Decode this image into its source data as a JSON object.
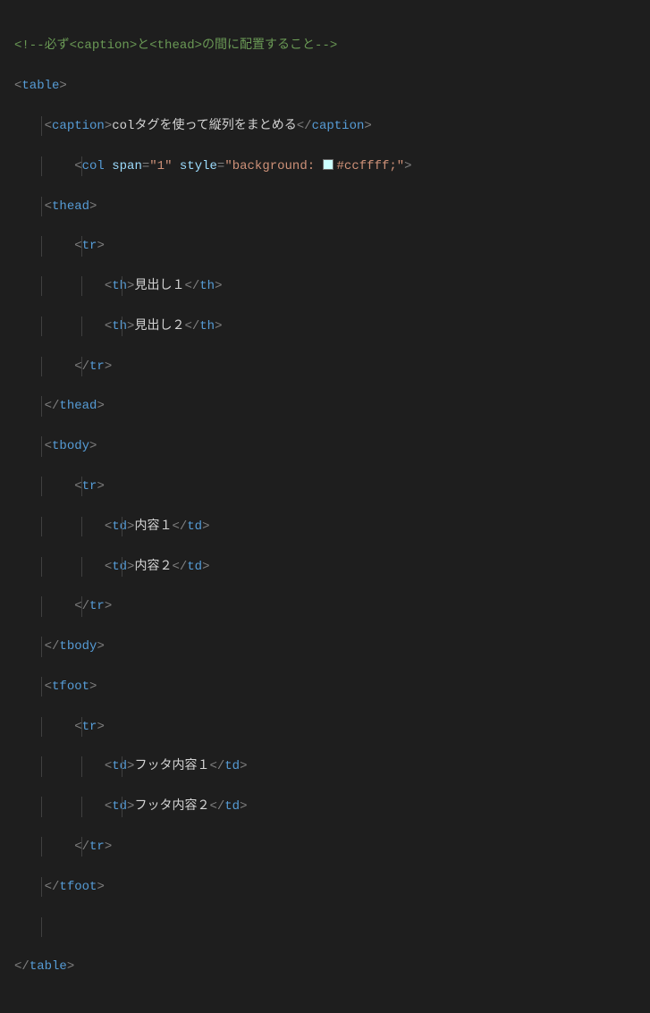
{
  "code": {
    "comment_prefix": "<!--",
    "comment_text1": "必ず",
    "comment_caption": "<caption>",
    "comment_text2": "と",
    "comment_thead": "<thead>",
    "comment_text3": "の間に配置すること",
    "comment_suffix": "-->",
    "table_open_lt": "<",
    "table_tag": "table",
    "gt": ">",
    "caption_tag": "caption",
    "caption_text": "colタグを使って縦列をまとめる",
    "lt_slash": "</",
    "col_tag": "col",
    "span_attr": "span",
    "eq": "=",
    "span_val": "\"1\"",
    "style_attr": "style",
    "style_val_before": "\"background: ",
    "style_val_after": "#ccffff;\"",
    "thead_tag": "thead",
    "tr_tag": "tr",
    "th_tag": "th",
    "th1_text": "見出し１",
    "th2_text": "見出し２",
    "tbody_tag": "tbody",
    "td_tag": "td",
    "td1_text": "内容１",
    "td2_text": "内容２",
    "tfoot_tag": "tfoot",
    "tf1_text": "フッタ内容１",
    "tf2_text": "フッタ内容２"
  },
  "colors": {
    "swatch": "#ccffff",
    "comment": "#6a9955",
    "tag": "#569cd6",
    "attr": "#9cdcfe",
    "string": "#ce9178",
    "punc": "#808080",
    "text": "#d4d4d4",
    "bg": "#1e1e1e"
  }
}
